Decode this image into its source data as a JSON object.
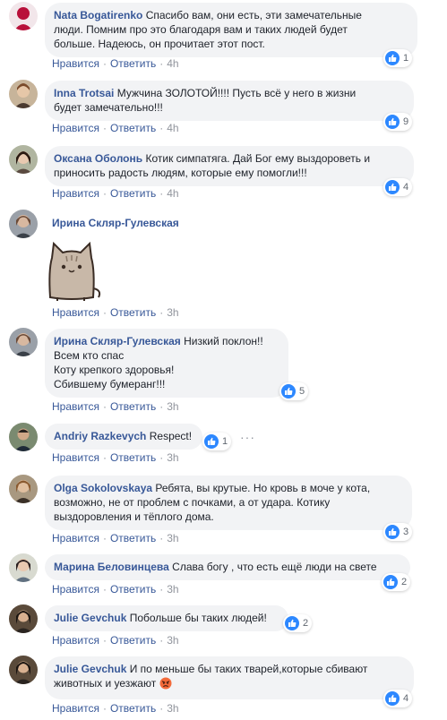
{
  "actions": {
    "like": "Нравится",
    "reply": "Ответить",
    "sep": "·"
  },
  "colors": {
    "accent": "#385898",
    "bubble": "#f2f3f5",
    "like": "#2d88ff"
  },
  "comments": [
    {
      "author": "Nata Bogatirenko",
      "lines": [
        "Спасибо вам, они есть, эти замечательные",
        "люди. Помним про это благодаря вам и таких людей будет",
        "больше. Надеюсь, он прочитает этот пост."
      ],
      "time": "4h",
      "likes": "1"
    },
    {
      "author": "Inna Trotsai",
      "lines": [
        "Мужчина ЗОЛОТОЙ!!!! Пусть всё у него в жизни",
        "будет замечательно!!!"
      ],
      "time": "4h",
      "likes": "9"
    },
    {
      "author": "Оксана Оболонь",
      "lines": [
        "Котик симпатяга. Дай Бог ему выздороветь и",
        "приносить радость людям, которые ему помогли!!!"
      ],
      "time": "4h",
      "likes": "4"
    },
    {
      "author": "Ирина Скляр-Гулевская",
      "lines": [
        ""
      ],
      "time": "3h",
      "likes": "",
      "sticker": "pusheen-cat-sticker"
    },
    {
      "author": "Ирина Скляр-Гулевская",
      "lines": [
        "Низкий поклон!!",
        "Всем кто спас",
        "Коту крепкого здоровья!",
        "Сбившему бумеранг!!!"
      ],
      "time": "3h",
      "likes": "5"
    },
    {
      "author": "Andriy Razkevych",
      "lines": [
        "Respect!"
      ],
      "time": "3h",
      "likes": "1",
      "more": "···"
    },
    {
      "author": "Olga Sokolovskaya",
      "lines": [
        "Ребята, вы крутые. Но кровь в моче у кота,",
        "возможно, не от проблем с почками, а от удара. Котику",
        "выздоровления и тёплого дома."
      ],
      "time": "3h",
      "likes": "3"
    },
    {
      "author": "Марина Беловинцева",
      "lines": [
        "Слава богу , что есть ещё люди на свете"
      ],
      "time": "3h",
      "likes": "2"
    },
    {
      "author": "Julie Gevchuk",
      "lines": [
        "Побольше бы таких людей!"
      ],
      "time": "3h",
      "likes": "2"
    },
    {
      "author": "Julie Gevchuk",
      "lines": [
        "И по меньше бы таких тварей,которые сбивают",
        "животных и уезжают"
      ],
      "time": "3h",
      "likes": "4",
      "emoji": "angry-face-emoji"
    }
  ]
}
